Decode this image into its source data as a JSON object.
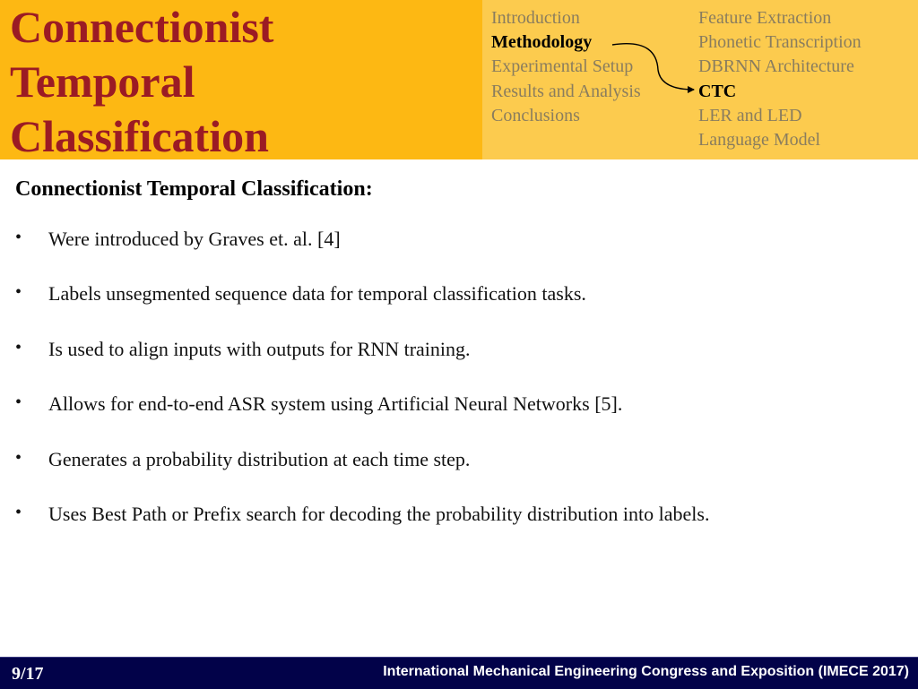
{
  "header": {
    "title_lines": [
      "Connectionist",
      "Temporal",
      "Classification"
    ],
    "colors": {
      "title_box_bg": "#FDB813",
      "nav_box_bg": "#FCCB4E",
      "title_text": "#9B1B24",
      "nav_inactive": "#8A7D5E",
      "nav_active": "#000000"
    },
    "nav": {
      "sections": [
        {
          "label": "Introduction",
          "active": false
        },
        {
          "label": "Methodology",
          "active": true
        },
        {
          "label": "Experimental Setup",
          "active": false
        },
        {
          "label": "Results and Analysis",
          "active": false
        },
        {
          "label": "Conclusions",
          "active": false
        }
      ],
      "subsections": [
        {
          "label": "Feature Extraction",
          "active": false
        },
        {
          "label": "Phonetic Transcription",
          "active": false
        },
        {
          "label": "DBRNN Architecture",
          "active": false
        },
        {
          "label": "CTC",
          "active": true
        },
        {
          "label": "LER and LED",
          "active": false
        },
        {
          "label": "Language Model",
          "active": false
        }
      ],
      "arrow": {
        "from": "Methodology",
        "to": "CTC",
        "icon": "curved-arrow-icon"
      }
    }
  },
  "content": {
    "heading": "Connectionist Temporal Classification:",
    "bullet_glyph": "•",
    "bullets": [
      "Were introduced by Graves et. al. [4]",
      "Labels unsegmented sequence data for temporal classification tasks.",
      "Is used to align inputs with outputs for RNN training.",
      "Allows for end-to-end ASR system using Artificial Neural Networks [5].",
      "Generates a probability distribution at each time step.",
      "Uses Best Path or Prefix search for decoding the probability distribution into labels."
    ]
  },
  "footer": {
    "page": "9/17",
    "conference": "International Mechanical Engineering Congress and Exposition (IMECE 2017)",
    "bg_color": "#020249"
  }
}
